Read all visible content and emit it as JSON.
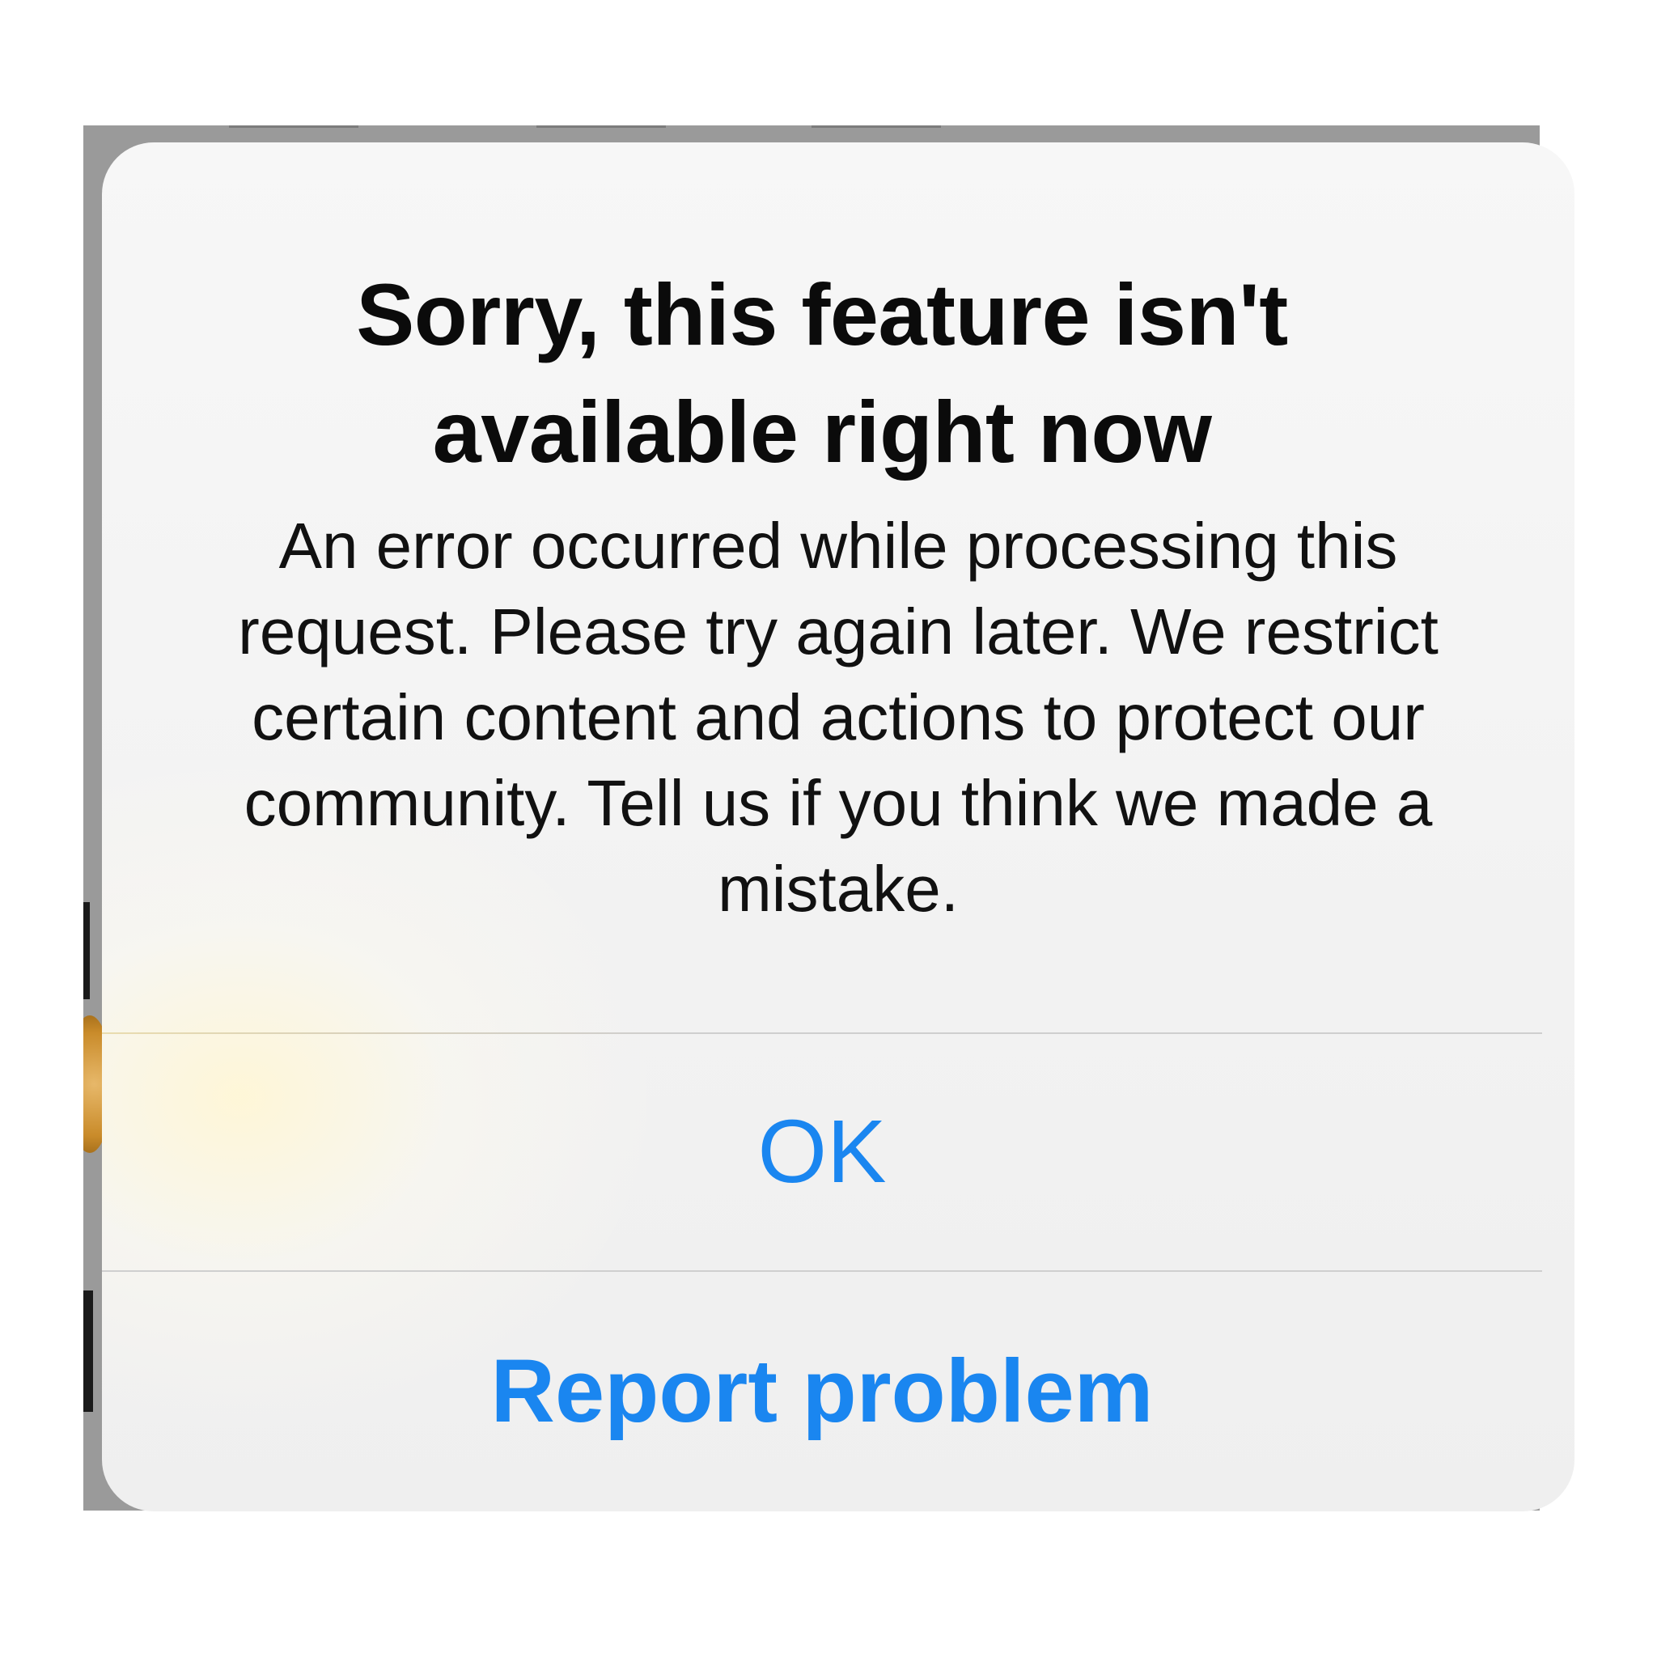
{
  "alert": {
    "title": "Sorry, this feature isn't available right now",
    "message": "An error occurred while processing this request. Please try again later. We restrict certain content and actions to protect our community. Tell us if you think we made a mistake.",
    "buttons": {
      "ok_label": "OK",
      "report_label": "Report problem"
    }
  },
  "colors": {
    "accent": "#1a86f0",
    "alert_background": "#f4f4f4",
    "divider": "#cfcfcf",
    "text": "#0b0b0b",
    "dimmed_backdrop": "#9a9a9a"
  }
}
